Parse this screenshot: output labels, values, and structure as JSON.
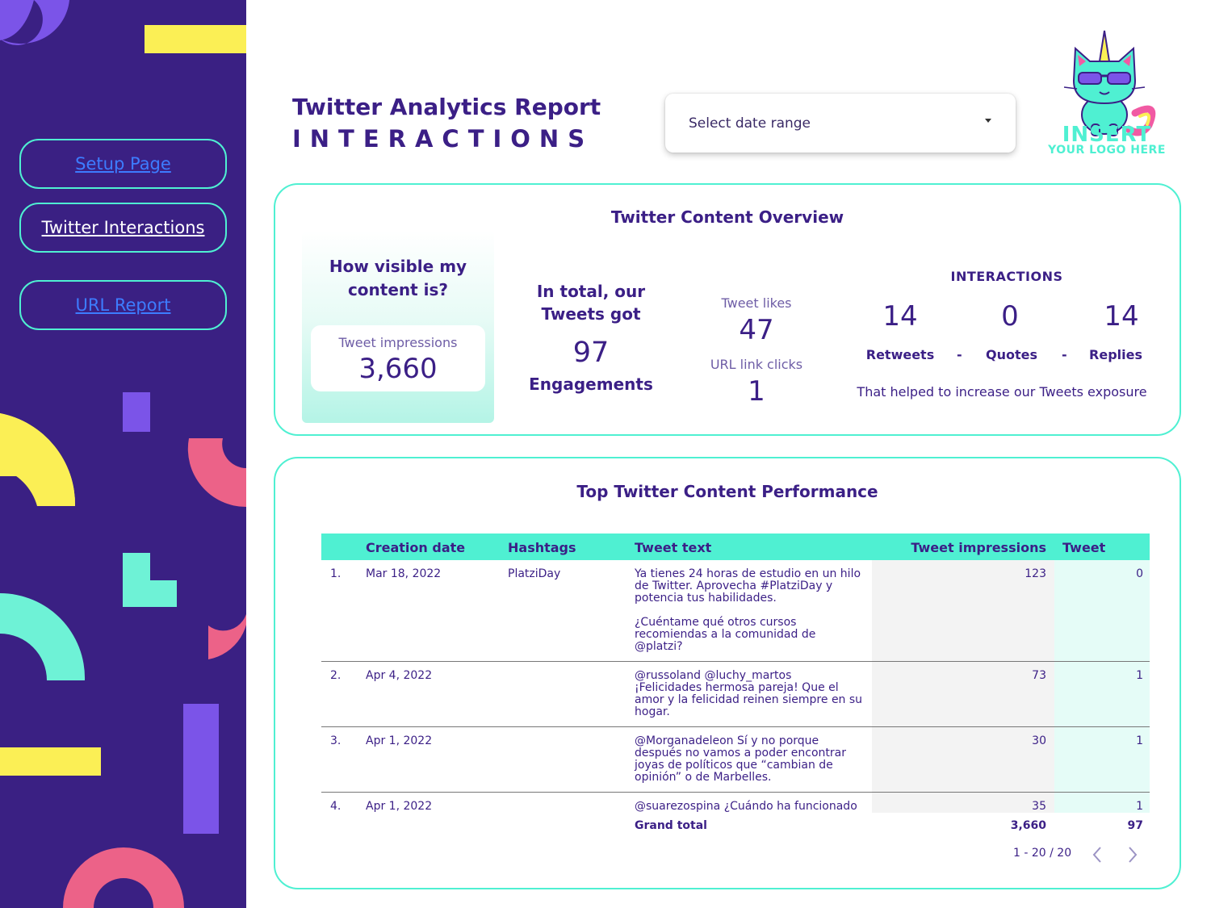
{
  "nav": {
    "setup": "Setup Page",
    "interactions": "Twitter Interactions",
    "url_report": "URL Report"
  },
  "header": {
    "title": "Twitter Analytics Report",
    "subtitle": "INTERACTIONS",
    "date_select": "Select date range"
  },
  "logo": {
    "line1": "INSERT",
    "line2": "YOUR LOGO HERE"
  },
  "overview": {
    "title": "Twitter Content Overview",
    "visibility_question": "How visible my content is?",
    "impressions_label": "Tweet impressions",
    "impressions_value": "3,660",
    "total_heading": "In total, our Tweets got",
    "engagements_value": "97",
    "engagements_label": "Engagements",
    "likes_label": "Tweet likes",
    "likes_value": "47",
    "clicks_label": "URL link clicks",
    "clicks_value": "1",
    "interactions_heading": "INTERACTIONS",
    "retweets_value": "14",
    "retweets_label": "Retweets",
    "quotes_value": "0",
    "quotes_label": "Quotes",
    "replies_value": "14",
    "replies_label": "Replies",
    "separator": "-",
    "note": "That helped to increase our Tweets exposure"
  },
  "table": {
    "title": "Top Twitter Content Performance",
    "columns": [
      "Creation date",
      "Hashtags",
      "Tweet text",
      "Tweet impressions",
      "Tweet eng..."
    ],
    "rows": [
      {
        "num": "1.",
        "date": "Mar 18, 2022",
        "hashtags": "PlatziDay",
        "text": "Ya tienes 24 horas de estudio en un hilo\nde Twitter. Aprovecha #PlatziDay y\npotencia tus habilidades.\n\n¿Cuéntame qué otros cursos\nrecomiendas a la comunidad de\n@platzi?",
        "impressions": "123",
        "engagements": "0"
      },
      {
        "num": "2.",
        "date": "Apr 4, 2022",
        "hashtags": "",
        "text": "@russoland @luchy_martos\n¡Felicidades hermosa pareja! Que el\namor y la felicidad reinen siempre en su\nhogar.",
        "impressions": "73",
        "engagements": "1"
      },
      {
        "num": "3.",
        "date": "Apr 1, 2022",
        "hashtags": "",
        "text": "@Morganadeleon Sí y no porque\ndespués no vamos a poder encontrar\njoyas de políticos que “cambian de\nopinión” o de Marbelles.",
        "impressions": "30",
        "engagements": "1"
      },
      {
        "num": "4.",
        "date": "Apr 1, 2022",
        "hashtags": "",
        "text": "@suarezospina ¿Cuándo ha funcionado",
        "impressions": "35",
        "engagements": "1"
      }
    ],
    "grand_total_label": "Grand total",
    "grand_total_impressions": "3,660",
    "grand_total_engagements": "97",
    "pagination": "1 - 20 / 20"
  },
  "colors": {
    "sidebar": "#3a2083",
    "accent": "#4ff0d2",
    "text": "#3b1f86",
    "yellow": "#fbef55",
    "violet": "#7b54e8",
    "pink": "#ec6288",
    "mint": "#6ef2d6"
  }
}
